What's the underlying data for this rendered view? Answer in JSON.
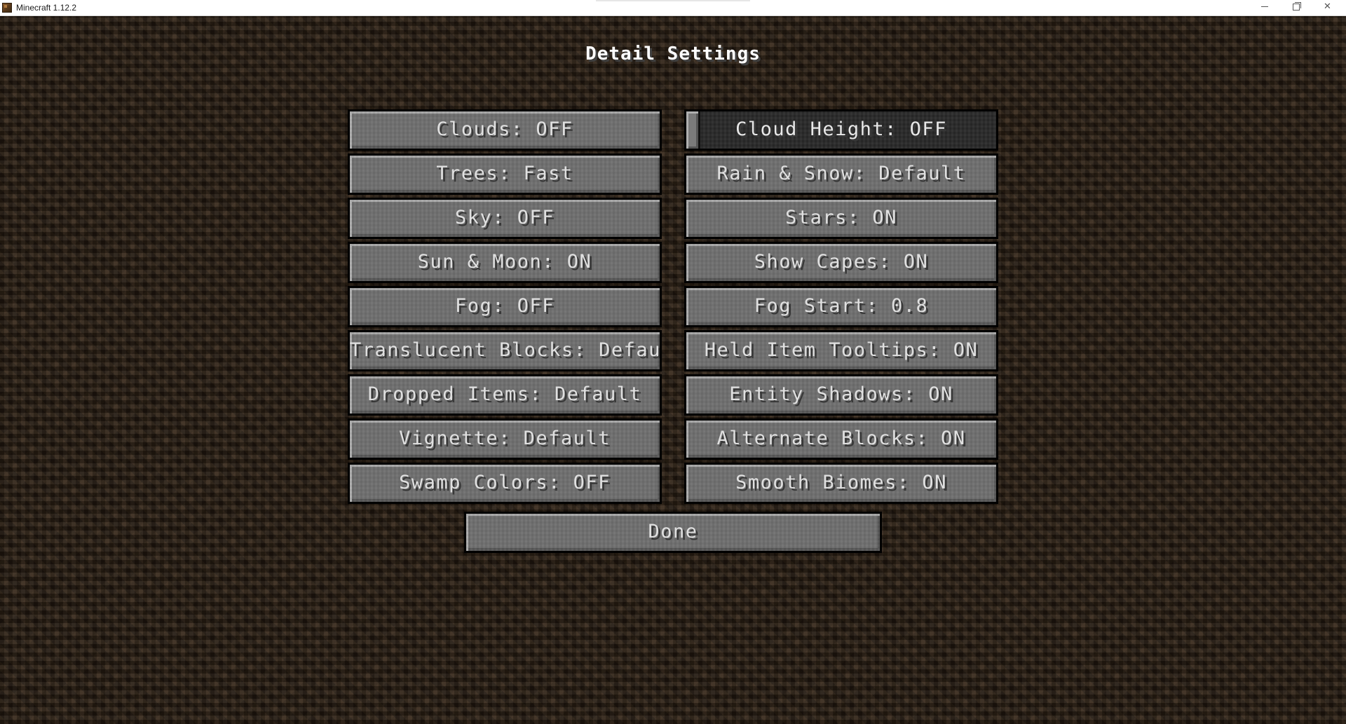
{
  "window": {
    "title": "Minecraft 1.12.2",
    "minimize_label": "",
    "maximize_label": "",
    "close_label": "✕"
  },
  "screen": {
    "title": "Detail Settings"
  },
  "options": {
    "left": [
      {
        "label": "Clouds: OFF"
      },
      {
        "label": "Trees: Fast"
      },
      {
        "label": "Sky: OFF"
      },
      {
        "label": "Sun & Moon: ON"
      },
      {
        "label": "Fog: OFF"
      },
      {
        "label": "Translucent Blocks: Default"
      },
      {
        "label": "Dropped Items: Default"
      },
      {
        "label": "Vignette: Default"
      },
      {
        "label": "Swamp Colors: OFF"
      }
    ],
    "right": [
      {
        "label": "Cloud Height: OFF",
        "type": "slider",
        "slider_value": 0
      },
      {
        "label": "Rain & Snow: Default"
      },
      {
        "label": "Stars: ON"
      },
      {
        "label": "Show Capes: ON"
      },
      {
        "label": "Fog Start: 0.8"
      },
      {
        "label": "Held Item Tooltips: ON"
      },
      {
        "label": "Entity Shadows: ON"
      },
      {
        "label": "Alternate Blocks: ON"
      },
      {
        "label": "Smooth Biomes: ON"
      }
    ]
  },
  "done_button": {
    "label": "Done"
  }
}
